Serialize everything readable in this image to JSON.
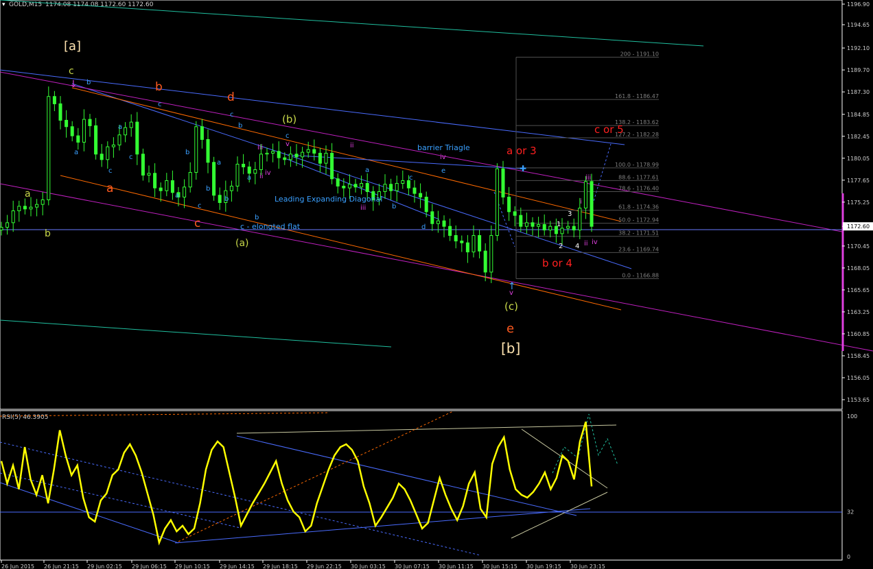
{
  "header": {
    "symbol": "GOLD,M15",
    "ohlc": "1174.08 1174.08 1172.60 1172.60"
  },
  "rsi_header": "RSI(5) 46.3905",
  "colors": {
    "candle": "#33ff33",
    "rsi": "#ffff00",
    "fib": "#808080",
    "wave_red": "#ff2020",
    "wave_orange": "#ff5a1f",
    "wave_yellowgreen": "#c8d84a",
    "wave_blue": "#3aa0ff",
    "wave_magenta": "#e040e0",
    "wave_white": "#ffffff",
    "wave_cream": "#ffe4b0",
    "trend_blue": "#4a6cff",
    "trend_orange": "#ff6a00",
    "trend_magenta": "#c020c0",
    "trend_teal": "#20c0a0",
    "price_line": "#6a7cff"
  },
  "chart_data": [
    {
      "type": "candlestick",
      "title": "GOLD,M15",
      "ylim": [
        1152.6,
        1197.2
      ],
      "y_ticks": [
        "1196.90",
        "1194.65",
        "1192.10",
        "1189.70",
        "1187.30",
        "1184.85",
        "1182.45",
        "1180.05",
        "1177.65",
        "1175.25",
        "1172.60",
        "1170.45",
        "1168.05",
        "1165.65",
        "1163.25",
        "1160.85",
        "1158.45",
        "1156.05",
        "1153.65"
      ],
      "current_price": "1172.60",
      "x_labels": [
        "26 Jun 2015",
        "26 Jun 21:15",
        "29 Jun 02:15",
        "29 Jun 06:15",
        "29 Jun 10:15",
        "29 Jun 14:15",
        "29 Jun 18:15",
        "29 Jun 22:15",
        "30 Jun 03:15",
        "30 Jun 07:15",
        "30 Jun 11:15",
        "30 Jun 15:15",
        "30 Jun 19:15",
        "30 Jun 23:15"
      ],
      "close_path": [
        1172.5,
        1173.0,
        1174.3,
        1174.8,
        1174.5,
        1174.7,
        1175.0,
        1175.5,
        1186.8,
        1186.0,
        1184.2,
        1183.5,
        1182.5,
        1181.8,
        1184.3,
        1183.6,
        1180.5,
        1179.9,
        1181.3,
        1181.5,
        1182.6,
        1183.4,
        1184.0,
        1180.5,
        1178.2,
        1178.4,
        1176.8,
        1176.5,
        1177.6,
        1176.3,
        1175.8,
        1176.9,
        1178.5,
        1183.5,
        1182.1,
        1179.6,
        1176.0,
        1175.2,
        1176.5,
        1177.0,
        1179.4,
        1179.1,
        1178.4,
        1178.8,
        1180.5,
        1180.6,
        1180.8,
        1180.1,
        1179.9,
        1180.5,
        1180.2,
        1180.7,
        1181.0,
        1180.6,
        1179.5,
        1180.6,
        1177.8,
        1177.0,
        1176.8,
        1177.2,
        1176.9,
        1177.3,
        1176.4,
        1175.5,
        1176.4,
        1177.2,
        1176.5,
        1177.3,
        1177.6,
        1176.8,
        1176.2,
        1175.8,
        1174.2,
        1172.9,
        1173.2,
        1172.6,
        1171.6,
        1171.0,
        1170.8,
        1169.8,
        1171.6,
        1169.9,
        1167.6,
        1171.6,
        1178.9,
        1175.8,
        1174.2,
        1173.8,
        1172.6,
        1173.0,
        1172.6,
        1172.8,
        1172.2,
        1172.6,
        1171.8,
        1172.4,
        1172.6,
        1172.2,
        1174.6,
        1177.5,
        1172.6
      ],
      "fibonacci": [
        {
          "level": "200 - 1191.10",
          "price": 1191.1
        },
        {
          "level": "161.8 - 1186.47",
          "price": 1186.47
        },
        {
          "level": "138.2 - 1183.62",
          "price": 1183.62
        },
        {
          "level": "127.2 - 1182.28",
          "price": 1182.28
        },
        {
          "level": "100.0 - 1178.99",
          "price": 1178.99
        },
        {
          "level": "88.6 - 1177.61",
          "price": 1177.61
        },
        {
          "level": "78.6 - 1176.40",
          "price": 1176.4
        },
        {
          "level": "61.8 - 1174.36",
          "price": 1174.36
        },
        {
          "level": "50.0 - 1172.94",
          "price": 1172.94
        },
        {
          "level": "38.2 - 1171.51",
          "price": 1171.51
        },
        {
          "level": "23.6 - 1169.74",
          "price": 1169.74
        },
        {
          "level": "0.0 - 1166.88",
          "price": 1166.88
        }
      ],
      "annotations": [
        {
          "text": "[a]",
          "color": "cream"
        },
        {
          "text": "c",
          "color": "yellowgreen"
        },
        {
          "text": "b",
          "color": "orange"
        },
        {
          "text": "d",
          "color": "orange"
        },
        {
          "text": "(b)",
          "color": "yellowgreen"
        },
        {
          "text": "a",
          "color": "orange"
        },
        {
          "text": "c",
          "color": "orange"
        },
        {
          "text": "(a)",
          "color": "yellowgreen"
        },
        {
          "text": "a",
          "color": "yellowgreen"
        },
        {
          "text": "b",
          "color": "yellowgreen"
        },
        {
          "text": "Leading Expanding Diagonal",
          "color": "blue"
        },
        {
          "text": "c - elongted flat",
          "color": "blue"
        },
        {
          "text": "barrier Triagle",
          "color": "blue"
        },
        {
          "text": "a or 3",
          "color": "red"
        },
        {
          "text": "b or 4",
          "color": "red"
        },
        {
          "text": "c or 5",
          "color": "red"
        },
        {
          "text": "(c)",
          "color": "yellowgreen"
        },
        {
          "text": "e",
          "color": "orange"
        },
        {
          "text": "[b]",
          "color": "cream"
        }
      ]
    },
    {
      "type": "line",
      "title": "RSI(5) 46.3905",
      "ylim": [
        0,
        100
      ],
      "y_ticks": [
        "100",
        "32",
        "0"
      ],
      "values": [
        68,
        52,
        65,
        48,
        78,
        55,
        44,
        58,
        38,
        62,
        90,
        72,
        58,
        65,
        42,
        28,
        25,
        40,
        45,
        58,
        62,
        74,
        80,
        72,
        60,
        45,
        30,
        10,
        20,
        26,
        18,
        22,
        16,
        20,
        38,
        62,
        76,
        82,
        78,
        60,
        42,
        22,
        30,
        38,
        45,
        52,
        60,
        68,
        52,
        40,
        32,
        28,
        18,
        22,
        38,
        50,
        62,
        72,
        78,
        80,
        76,
        68,
        50,
        38,
        22,
        28,
        35,
        42,
        52,
        48,
        40,
        30,
        20,
        24,
        40,
        56,
        44,
        34,
        26,
        36,
        52,
        60,
        34,
        28,
        66,
        78,
        85,
        62,
        48,
        44,
        42,
        46,
        52,
        60,
        48,
        56,
        72,
        68,
        55,
        82,
        96,
        50
      ]
    }
  ]
}
